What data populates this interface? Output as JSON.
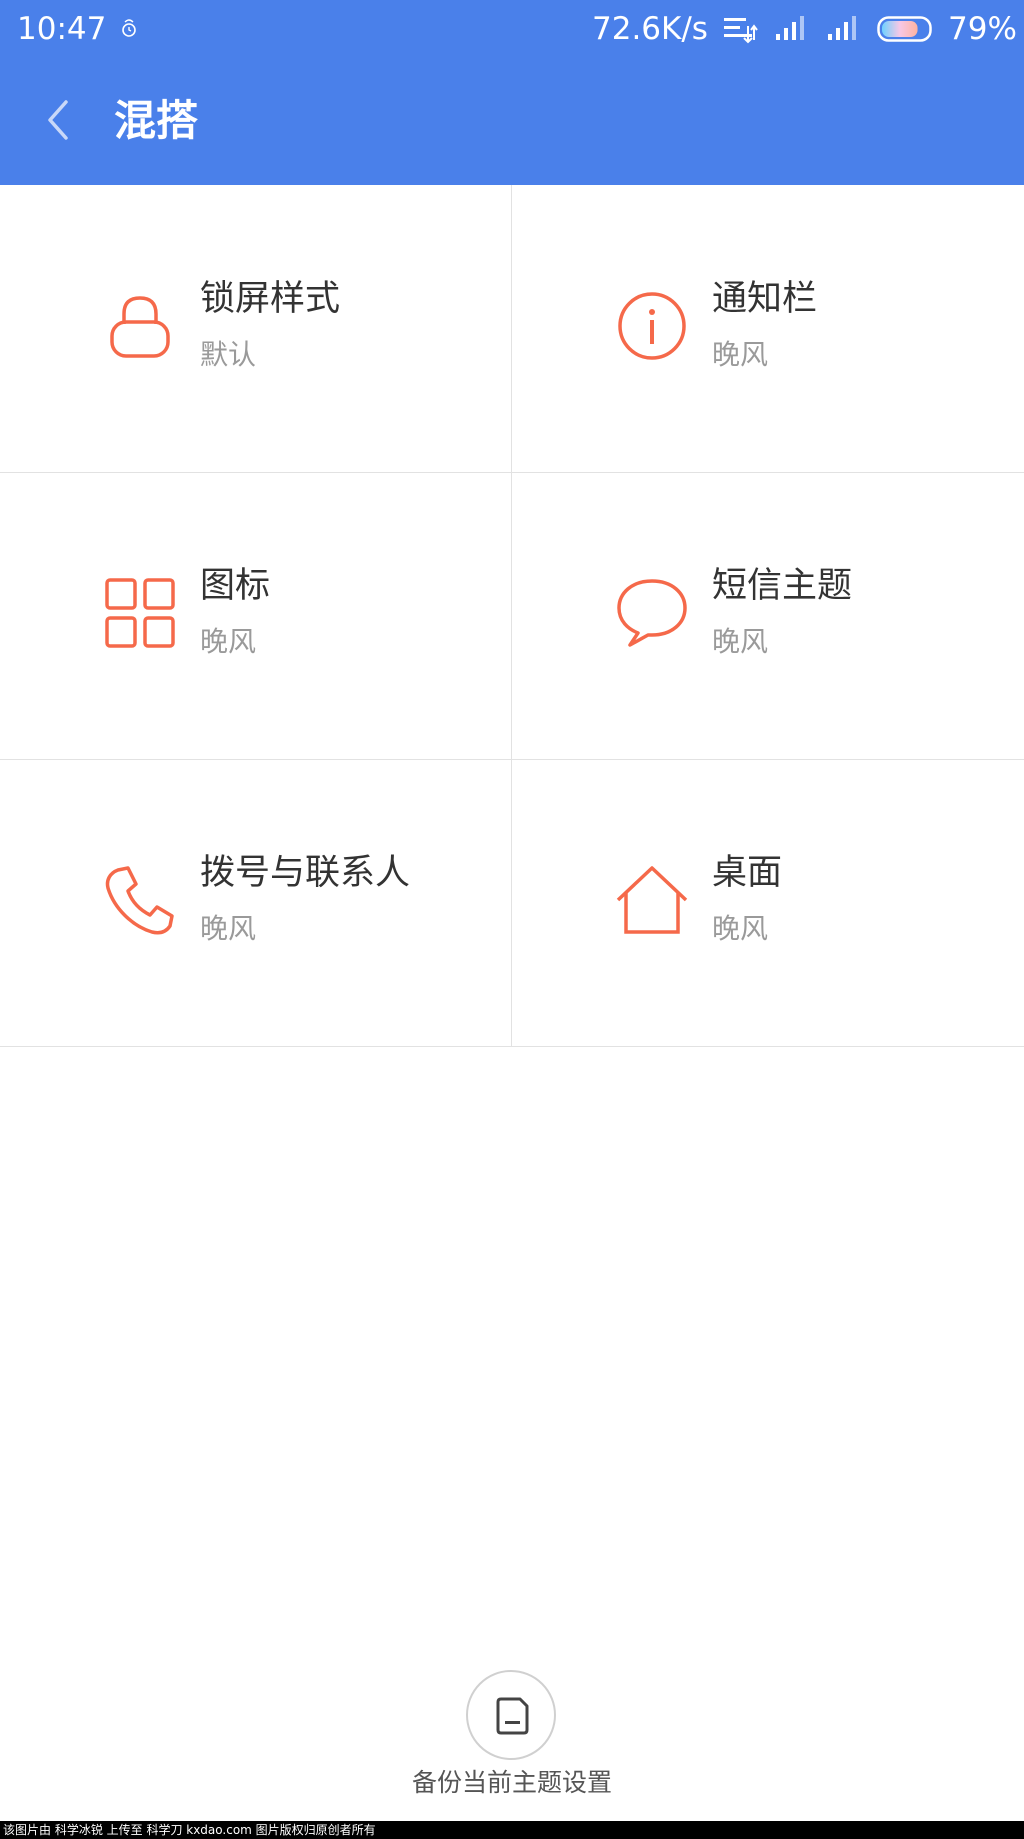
{
  "status_bar": {
    "time": "10:47",
    "network_speed": "72.6K/s",
    "battery_percent": "79%",
    "battery_level": 0.79,
    "icons": [
      "alarm-icon",
      "data-transfer-icon",
      "signal-icon",
      "signal-icon",
      "battery-icon"
    ]
  },
  "app_bar": {
    "title": "混搭",
    "back_icon": "chevron-left-icon",
    "background_color": "#4a80ea"
  },
  "grid": {
    "accent_color": "#f5694a",
    "items": [
      {
        "title": "锁屏样式",
        "value": "默认",
        "icon": "lock-icon"
      },
      {
        "title": "通知栏",
        "value": "晚风",
        "icon": "info-icon"
      },
      {
        "title": "图标",
        "value": "晚风",
        "icon": "grid-icon"
      },
      {
        "title": "短信主题",
        "value": "晚风",
        "icon": "chat-bubble-icon"
      },
      {
        "title": "拨号与联系人",
        "value": "晚风",
        "icon": "phone-icon"
      },
      {
        "title": "桌面",
        "value": "晚风",
        "icon": "home-icon"
      }
    ]
  },
  "backup": {
    "label": "备份当前主题设置",
    "icon": "save-card-icon"
  },
  "watermark": "该图片由 科学冰锐 上传至 科学刀 kxdao.com 图片版权归原创者所有"
}
